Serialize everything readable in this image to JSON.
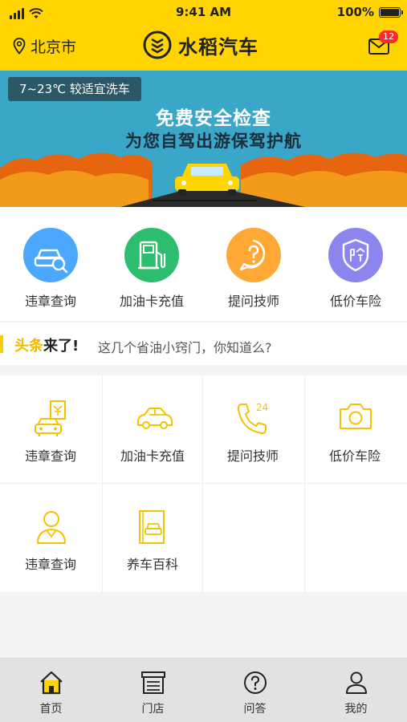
{
  "status_bar": {
    "time": "9:41 AM",
    "battery": "100%",
    "battery_level": 1.0
  },
  "nav": {
    "city": "北京市",
    "brand": "水稻汽车",
    "mail_badge": "12"
  },
  "banner": {
    "weather": "7~23℃  较适宜洗车",
    "title": "免费安全检查",
    "subtitle": "为您自驾出游保驾护航"
  },
  "quick_actions": [
    {
      "label": "违章查询",
      "color": "#4aa8ff",
      "icon": "car-search-icon"
    },
    {
      "label": "加油卡充值",
      "color": "#2dbd6e",
      "icon": "fuel-pump-icon"
    },
    {
      "label": "提问技师",
      "color": "#ffa836",
      "icon": "question-icon"
    },
    {
      "label": "低价车险",
      "color": "#8b86ee",
      "icon": "insurance-shield-icon"
    }
  ],
  "news": {
    "tag_highlight": "头条",
    "tag_rest": "来了!",
    "text": "这几个省油小窍门，你知道么?"
  },
  "grid_items": [
    {
      "label": "违章查询",
      "icon": "car-ticket-icon"
    },
    {
      "label": "加油卡充值",
      "icon": "car-icon"
    },
    {
      "label": "提问技师",
      "icon": "phone-24-icon"
    },
    {
      "label": "低价车险",
      "icon": "camera-icon"
    },
    {
      "label": "违章查询",
      "icon": "person-icon"
    },
    {
      "label": "养车百科",
      "icon": "car-book-icon"
    }
  ],
  "tabs": [
    {
      "label": "首页",
      "icon": "home-icon"
    },
    {
      "label": "门店",
      "icon": "store-icon"
    },
    {
      "label": "问答",
      "icon": "question-icon"
    },
    {
      "label": "我的",
      "icon": "user-icon"
    }
  ],
  "colors": {
    "brand": "#ffd400",
    "banner_sky": "#3aa7c9",
    "accent_yellow": "#f5b800",
    "badge": "#ff2a2a"
  }
}
